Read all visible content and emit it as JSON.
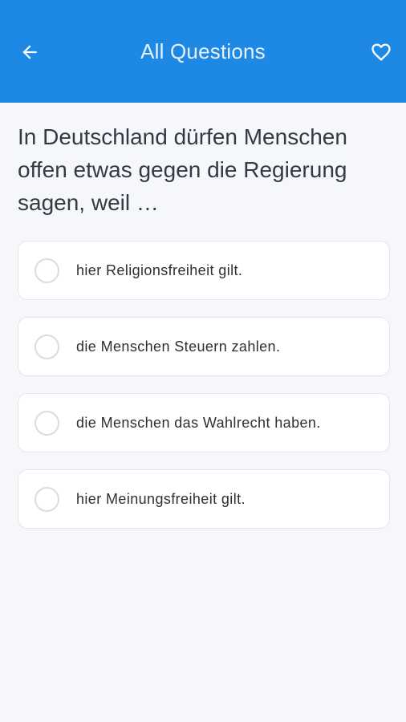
{
  "app_bar": {
    "title": "All Questions",
    "back_icon": "arrow-left-icon",
    "favorite_icon": "heart-outline-icon",
    "background_color": "#1e88e5"
  },
  "question": {
    "text": "In Deutschland dürfen Menschen offen etwas gegen die Regierung sagen, weil …"
  },
  "options": [
    {
      "label": "hier Religionsfreiheit gilt."
    },
    {
      "label": "die Menschen Steuern zahlen."
    },
    {
      "label": "die Menschen das Wahlrecht haben."
    },
    {
      "label": "hier Meinungsfreiheit gilt."
    }
  ]
}
